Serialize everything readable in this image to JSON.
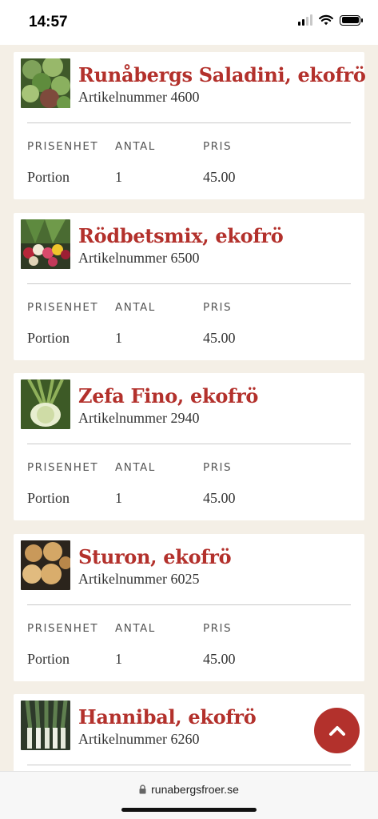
{
  "status": {
    "time": "14:57"
  },
  "columns": {
    "unit": "PRISENHET",
    "qty": "ANTAL",
    "price": "PRIS"
  },
  "products": [
    {
      "name": "Runåbergs Saladini, ekofrö",
      "article": "Artikelnummer 4600",
      "unit": "Portion",
      "qty": "1",
      "price": "45.00"
    },
    {
      "name": "Rödbetsmix, ekofrö",
      "article": "Artikelnummer 6500",
      "unit": "Portion",
      "qty": "1",
      "price": "45.00"
    },
    {
      "name": "Zefa Fino, ekofrö",
      "article": "Artikelnummer 2940",
      "unit": "Portion",
      "qty": "1",
      "price": "45.00"
    },
    {
      "name": "Sturon, ekofrö",
      "article": "Artikelnummer 6025",
      "unit": "Portion",
      "qty": "1",
      "price": "45.00"
    },
    {
      "name": "Hannibal, ekofrö",
      "article": "Artikelnummer 6260",
      "unit": "",
      "qty": "",
      "price": ""
    }
  ],
  "browser": {
    "url": "runabergsfroer.se"
  },
  "colors": {
    "accent": "#b3312c",
    "background": "#f4efe6"
  }
}
